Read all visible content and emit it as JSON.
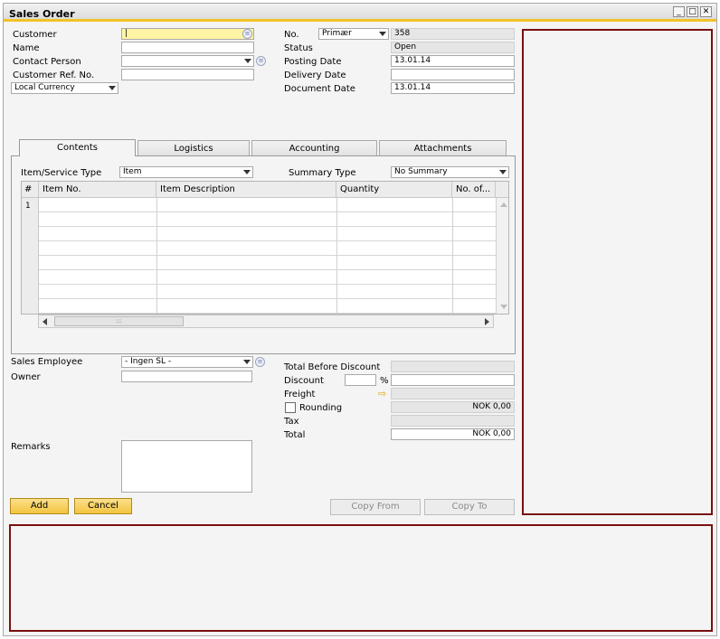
{
  "window": {
    "title": "Sales Order",
    "min": "_",
    "max": "□",
    "close": "✕"
  },
  "header_left": {
    "customer_label": "Customer",
    "customer_value": "|",
    "name_label": "Name",
    "name_value": "",
    "contact_label": "Contact Person",
    "contact_value": "",
    "custref_label": "Customer Ref. No.",
    "custref_value": "",
    "currency_value": "Local Currency"
  },
  "header_right": {
    "no_label": "No.",
    "series_value": "Primær",
    "no_value": "358",
    "status_label": "Status",
    "status_value": "Open",
    "posting_label": "Posting Date",
    "posting_value": "13.01.14",
    "delivery_label": "Delivery Date",
    "delivery_value": "",
    "docdate_label": "Document Date",
    "docdate_value": "13.01.14"
  },
  "tabs": [
    "Contents",
    "Logistics",
    "Accounting",
    "Attachments"
  ],
  "contents": {
    "item_type_label": "Item/Service Type",
    "item_type_value": "Item",
    "summary_label": "Summary Type",
    "summary_value": "No Summary",
    "columns": [
      "#",
      "Item No.",
      "Item Description",
      "Quantity",
      "No. of..."
    ],
    "first_row_number": "1"
  },
  "footer_left": {
    "sales_emp_label": "Sales Employee",
    "sales_emp_value": "- Ingen SL -",
    "owner_label": "Owner",
    "owner_value": "",
    "remarks_label": "Remarks"
  },
  "totals": {
    "before_discount_label": "Total Before Discount",
    "before_discount_value": "",
    "discount_label": "Discount",
    "discount_pct": "",
    "percent_sign": "%",
    "discount_value": "",
    "freight_label": "Freight",
    "freight_value": "",
    "rounding_label": "Rounding",
    "rounding_value": "NOK 0,00",
    "tax_label": "Tax",
    "tax_value": "",
    "total_label": "Total",
    "total_value": "NOK 0,00"
  },
  "buttons": {
    "add": "Add",
    "cancel": "Cancel",
    "copy_from": "Copy From",
    "copy_to": "Copy To"
  },
  "scrollbar": {
    "grip": ":::"
  }
}
